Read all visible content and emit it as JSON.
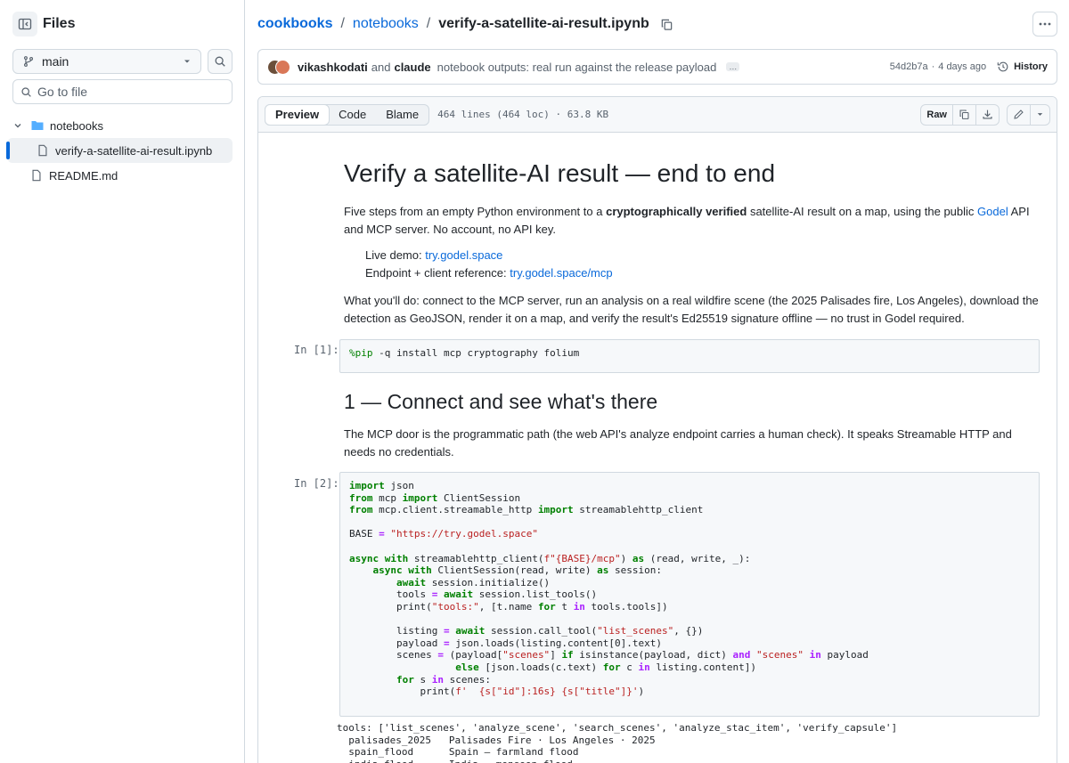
{
  "sidebar": {
    "title": "Files",
    "branch": "main",
    "goto_placeholder": "Go to file",
    "tree": [
      {
        "label": "notebooks",
        "type": "folder"
      },
      {
        "label": "verify-a-satellite-ai-result.ipynb",
        "type": "file",
        "selected": true
      },
      {
        "label": "README.md",
        "type": "file"
      }
    ]
  },
  "breadcrumb": {
    "repo": "cookbooks",
    "folder": "notebooks",
    "file": "verify-a-satellite-ai-result.ipynb",
    "sep": "/"
  },
  "commit": {
    "author1": "vikashkodati",
    "and": "and",
    "author2": "claude",
    "message": "notebook outputs: real run against the release payload",
    "sha": "54d2b7a",
    "dot": "·",
    "age": "4 days ago",
    "history_label": "History"
  },
  "file_header": {
    "tabs": [
      "Preview",
      "Code",
      "Blame"
    ],
    "active_tab": "Preview",
    "info": "464 lines (464 loc) · 63.8 KB",
    "raw_label": "Raw"
  },
  "notebook": {
    "title": "Verify a satellite-AI result — end to end",
    "intro_a": "Five steps from an empty Python environment to a ",
    "intro_bold": "cryptographically verified",
    "intro_b": " satellite-AI result on a map, using the public ",
    "intro_link": "Godel",
    "intro_c": " API and MCP server. No account, no API key.",
    "live_label": "Live demo: ",
    "live_link": "try.godel.space",
    "endpoint_label": "Endpoint + client reference: ",
    "endpoint_link": "try.godel.space/mcp",
    "what": "What you'll do: connect to the MCP server, run an analysis on a real wildfire scene (the 2025 Palisades fire, Los Angeles), download the detection as GeoJSON, render it on a map, and verify the result's Ed25519 signature offline — no trust in Godel required.",
    "cell1_prompt": "In [1]:",
    "cell1_code": "%pip -q install mcp cryptography folium",
    "section1": "1 — Connect and see what's there",
    "section1_text": "The MCP door is the programmatic path (the web API's analyze endpoint carries a human check). It speaks Streamable HTTP and needs no credentials.",
    "cell2_prompt": "In [2]:",
    "output": "tools: ['list_scenes', 'analyze_scene', 'search_scenes', 'analyze_stac_item', 'verify_capsule']\n  palisades_2025   Palisades Fire · Los Angeles · 2025\n  spain_flood      Spain — farmland flood\n  india_flood      India — monsoon flood"
  }
}
